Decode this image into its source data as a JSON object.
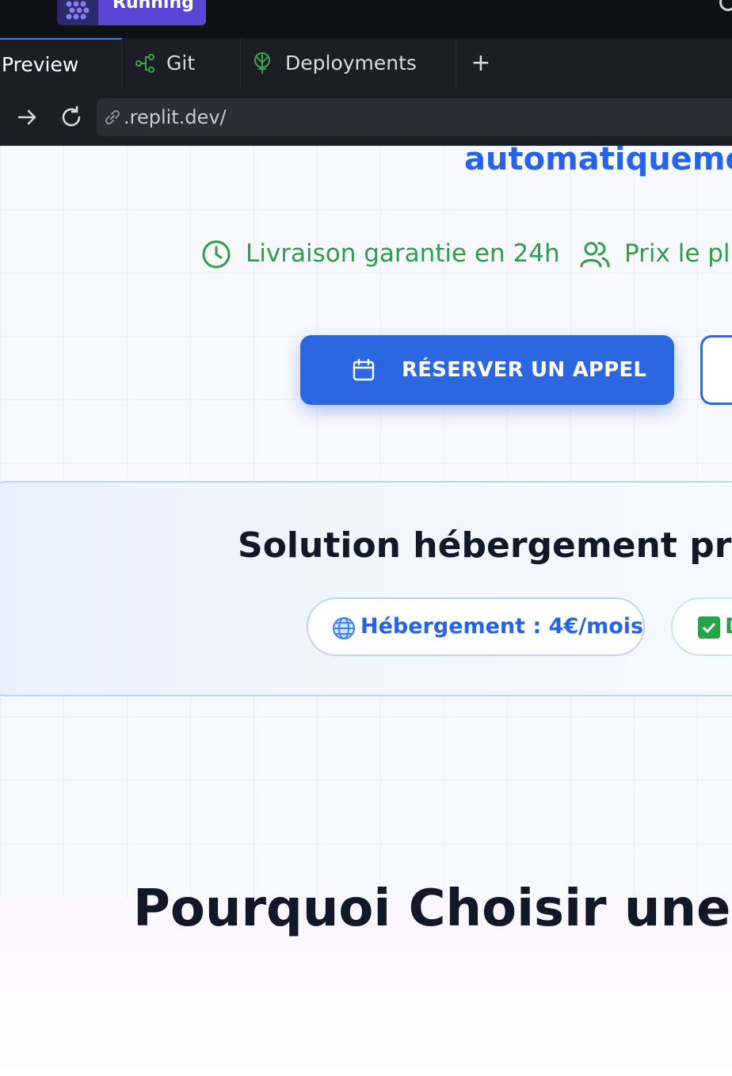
{
  "topbar": {
    "run_label": "Running",
    "brand_color": "#5b45d6"
  },
  "tabs": [
    {
      "label": "Preview",
      "active": true
    },
    {
      "label": "Git",
      "icon": "git-branch-icon"
    },
    {
      "label": "Deployments",
      "icon": "deploy-icon"
    }
  ],
  "tab_add": "+",
  "urlbar": {
    "url": ".replit.dev/"
  },
  "hero": {
    "headline_tail": "automatiquement",
    "features": [
      {
        "label": "Livraison garantie en 24h",
        "icon": "clock-icon"
      },
      {
        "label": "Prix le plu",
        "icon": "users-icon"
      }
    ],
    "cta_label": "RÉSERVER UN APPEL",
    "accent_color": "#2b67e0",
    "feature_color": "#2f9e4a"
  },
  "card": {
    "title": "Solution hébergement pro a",
    "pills": [
      {
        "label": "Hébergement : 4€/mois",
        "icon": "globe-icon"
      },
      {
        "label": "D",
        "icon": "check-icon"
      }
    ]
  },
  "section2": {
    "title": "Pourquoi Choisir une I"
  }
}
